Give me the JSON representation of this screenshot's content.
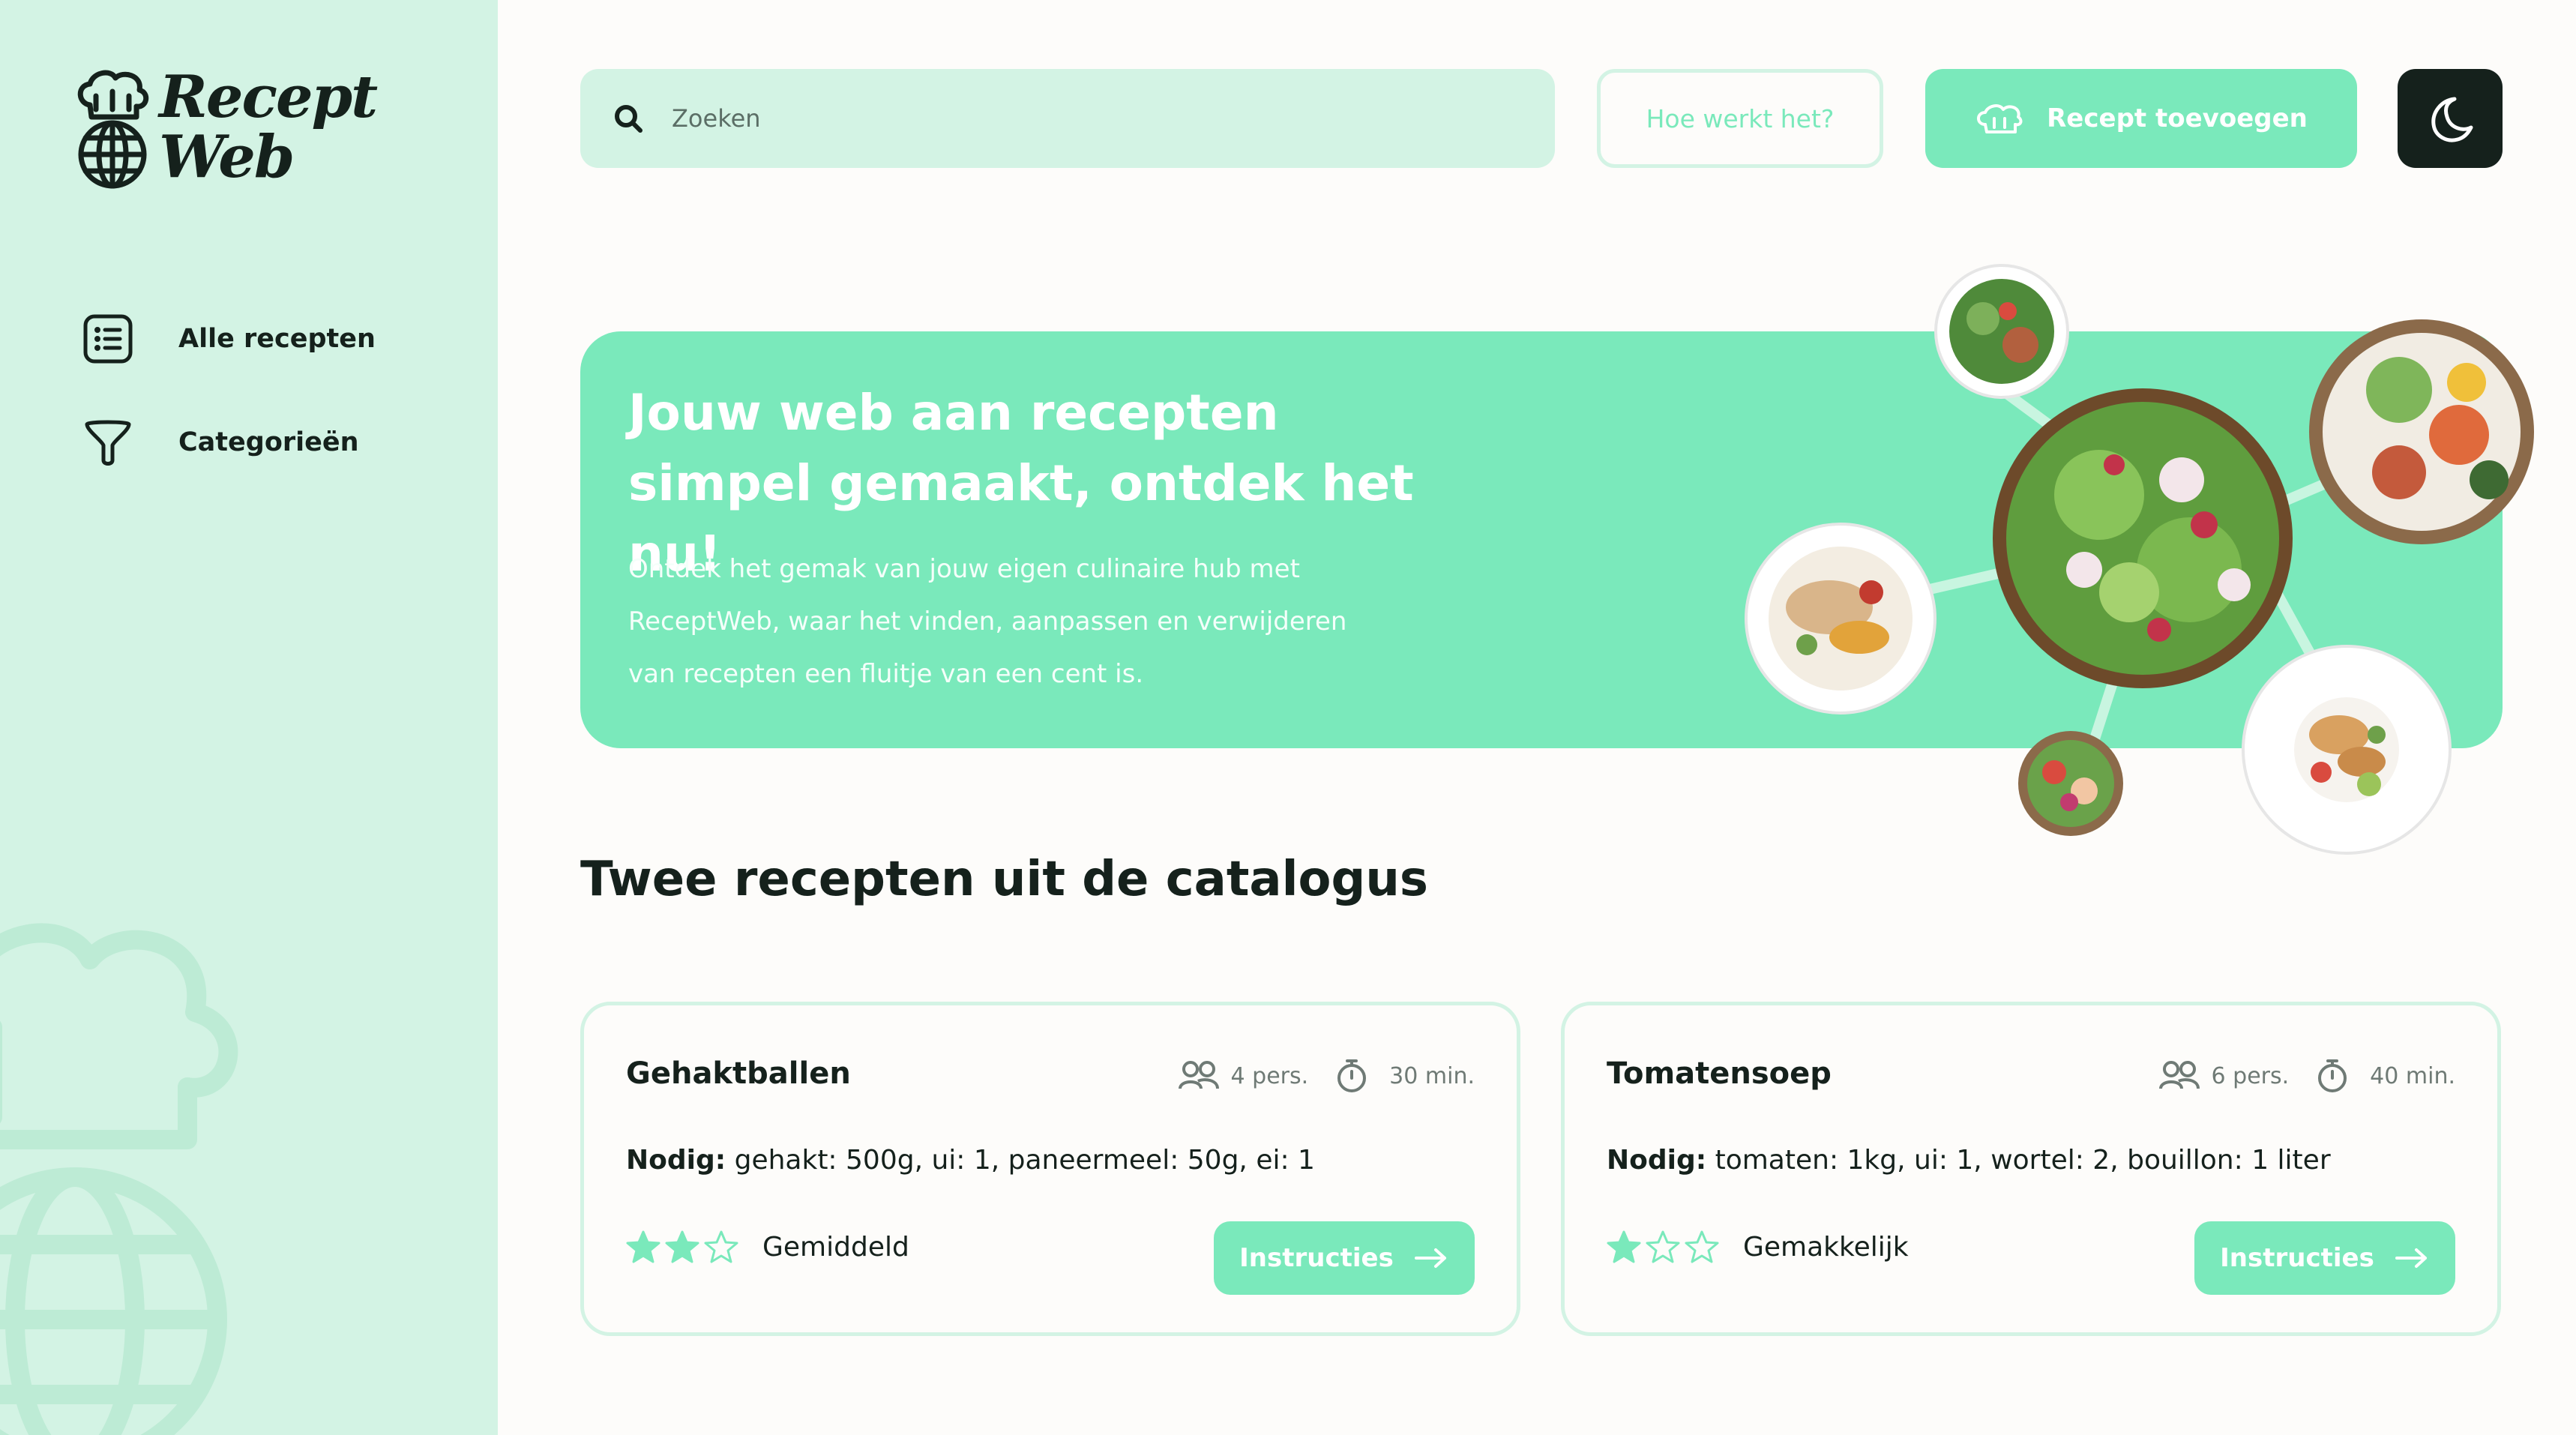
{
  "app": {
    "logo_line1": "Recept",
    "logo_line2": "Web"
  },
  "sidebar": {
    "items": [
      {
        "label": "Alle recepten",
        "icon": "list-icon"
      },
      {
        "label": "Categorieën",
        "icon": "filter-icon"
      }
    ]
  },
  "topbar": {
    "search_placeholder": "Zoeken",
    "how_label": "Hoe werkt het?",
    "add_label": "Recept toevoegen",
    "theme_icon": "moon-icon"
  },
  "hero": {
    "title": "Jouw web aan recepten simpel gemaakt, ontdek het nu!",
    "text": "Ontdek het gemak van jouw eigen culinaire hub met ReceptWeb, waar het vinden, aanpassen en verwijderen van recepten een fluitje van een cent is."
  },
  "section": {
    "title": "Twee recepten uit de catalogus"
  },
  "recipes": [
    {
      "name": "Gehaktballen",
      "persons": "4 pers.",
      "time": "30 min.",
      "needed_label": "Nodig:",
      "ingredients": "gehakt: 500g, ui: 1, paneermeel: 50g, ei: 1",
      "rating": 2,
      "rating_max": 3,
      "difficulty": "Gemiddeld",
      "button": "Instructies"
    },
    {
      "name": "Tomatensoep",
      "persons": "6 pers.",
      "time": "40 min.",
      "needed_label": "Nodig:",
      "ingredients": "tomaten: 1kg, ui: 1, wortel: 2, bouillon: 1 liter",
      "rating": 1,
      "rating_max": 3,
      "difficulty": "Gemakkelijk",
      "button": "Instructies"
    }
  ],
  "colors": {
    "accent": "#7ae9bb",
    "sidebar_bg": "#d3f3e4",
    "dark": "#15211c",
    "page_bg": "#fdfcfa"
  }
}
